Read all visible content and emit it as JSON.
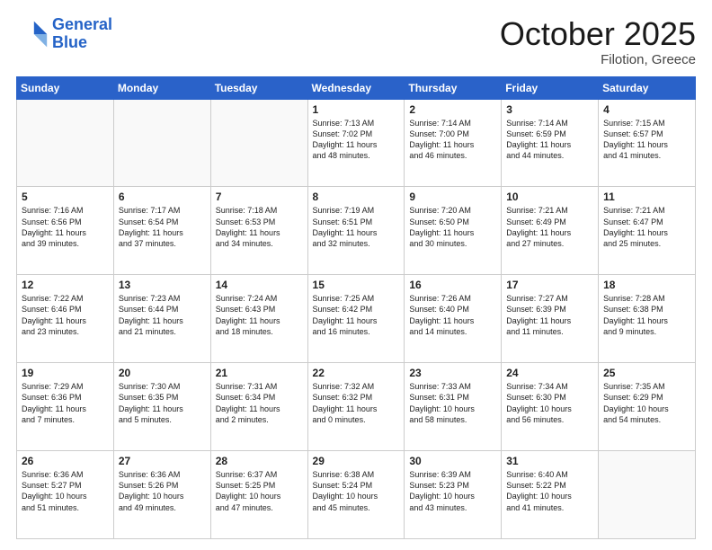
{
  "header": {
    "logo_line1": "General",
    "logo_line2": "Blue",
    "title": "October 2025",
    "subtitle": "Filotion, Greece"
  },
  "days_of_week": [
    "Sunday",
    "Monday",
    "Tuesday",
    "Wednesday",
    "Thursday",
    "Friday",
    "Saturday"
  ],
  "weeks": [
    [
      {
        "day": "",
        "info": ""
      },
      {
        "day": "",
        "info": ""
      },
      {
        "day": "",
        "info": ""
      },
      {
        "day": "1",
        "info": "Sunrise: 7:13 AM\nSunset: 7:02 PM\nDaylight: 11 hours\nand 48 minutes."
      },
      {
        "day": "2",
        "info": "Sunrise: 7:14 AM\nSunset: 7:00 PM\nDaylight: 11 hours\nand 46 minutes."
      },
      {
        "day": "3",
        "info": "Sunrise: 7:14 AM\nSunset: 6:59 PM\nDaylight: 11 hours\nand 44 minutes."
      },
      {
        "day": "4",
        "info": "Sunrise: 7:15 AM\nSunset: 6:57 PM\nDaylight: 11 hours\nand 41 minutes."
      }
    ],
    [
      {
        "day": "5",
        "info": "Sunrise: 7:16 AM\nSunset: 6:56 PM\nDaylight: 11 hours\nand 39 minutes."
      },
      {
        "day": "6",
        "info": "Sunrise: 7:17 AM\nSunset: 6:54 PM\nDaylight: 11 hours\nand 37 minutes."
      },
      {
        "day": "7",
        "info": "Sunrise: 7:18 AM\nSunset: 6:53 PM\nDaylight: 11 hours\nand 34 minutes."
      },
      {
        "day": "8",
        "info": "Sunrise: 7:19 AM\nSunset: 6:51 PM\nDaylight: 11 hours\nand 32 minutes."
      },
      {
        "day": "9",
        "info": "Sunrise: 7:20 AM\nSunset: 6:50 PM\nDaylight: 11 hours\nand 30 minutes."
      },
      {
        "day": "10",
        "info": "Sunrise: 7:21 AM\nSunset: 6:49 PM\nDaylight: 11 hours\nand 27 minutes."
      },
      {
        "day": "11",
        "info": "Sunrise: 7:21 AM\nSunset: 6:47 PM\nDaylight: 11 hours\nand 25 minutes."
      }
    ],
    [
      {
        "day": "12",
        "info": "Sunrise: 7:22 AM\nSunset: 6:46 PM\nDaylight: 11 hours\nand 23 minutes."
      },
      {
        "day": "13",
        "info": "Sunrise: 7:23 AM\nSunset: 6:44 PM\nDaylight: 11 hours\nand 21 minutes."
      },
      {
        "day": "14",
        "info": "Sunrise: 7:24 AM\nSunset: 6:43 PM\nDaylight: 11 hours\nand 18 minutes."
      },
      {
        "day": "15",
        "info": "Sunrise: 7:25 AM\nSunset: 6:42 PM\nDaylight: 11 hours\nand 16 minutes."
      },
      {
        "day": "16",
        "info": "Sunrise: 7:26 AM\nSunset: 6:40 PM\nDaylight: 11 hours\nand 14 minutes."
      },
      {
        "day": "17",
        "info": "Sunrise: 7:27 AM\nSunset: 6:39 PM\nDaylight: 11 hours\nand 11 minutes."
      },
      {
        "day": "18",
        "info": "Sunrise: 7:28 AM\nSunset: 6:38 PM\nDaylight: 11 hours\nand 9 minutes."
      }
    ],
    [
      {
        "day": "19",
        "info": "Sunrise: 7:29 AM\nSunset: 6:36 PM\nDaylight: 11 hours\nand 7 minutes."
      },
      {
        "day": "20",
        "info": "Sunrise: 7:30 AM\nSunset: 6:35 PM\nDaylight: 11 hours\nand 5 minutes."
      },
      {
        "day": "21",
        "info": "Sunrise: 7:31 AM\nSunset: 6:34 PM\nDaylight: 11 hours\nand 2 minutes."
      },
      {
        "day": "22",
        "info": "Sunrise: 7:32 AM\nSunset: 6:32 PM\nDaylight: 11 hours\nand 0 minutes."
      },
      {
        "day": "23",
        "info": "Sunrise: 7:33 AM\nSunset: 6:31 PM\nDaylight: 10 hours\nand 58 minutes."
      },
      {
        "day": "24",
        "info": "Sunrise: 7:34 AM\nSunset: 6:30 PM\nDaylight: 10 hours\nand 56 minutes."
      },
      {
        "day": "25",
        "info": "Sunrise: 7:35 AM\nSunset: 6:29 PM\nDaylight: 10 hours\nand 54 minutes."
      }
    ],
    [
      {
        "day": "26",
        "info": "Sunrise: 6:36 AM\nSunset: 5:27 PM\nDaylight: 10 hours\nand 51 minutes."
      },
      {
        "day": "27",
        "info": "Sunrise: 6:36 AM\nSunset: 5:26 PM\nDaylight: 10 hours\nand 49 minutes."
      },
      {
        "day": "28",
        "info": "Sunrise: 6:37 AM\nSunset: 5:25 PM\nDaylight: 10 hours\nand 47 minutes."
      },
      {
        "day": "29",
        "info": "Sunrise: 6:38 AM\nSunset: 5:24 PM\nDaylight: 10 hours\nand 45 minutes."
      },
      {
        "day": "30",
        "info": "Sunrise: 6:39 AM\nSunset: 5:23 PM\nDaylight: 10 hours\nand 43 minutes."
      },
      {
        "day": "31",
        "info": "Sunrise: 6:40 AM\nSunset: 5:22 PM\nDaylight: 10 hours\nand 41 minutes."
      },
      {
        "day": "",
        "info": ""
      }
    ]
  ]
}
